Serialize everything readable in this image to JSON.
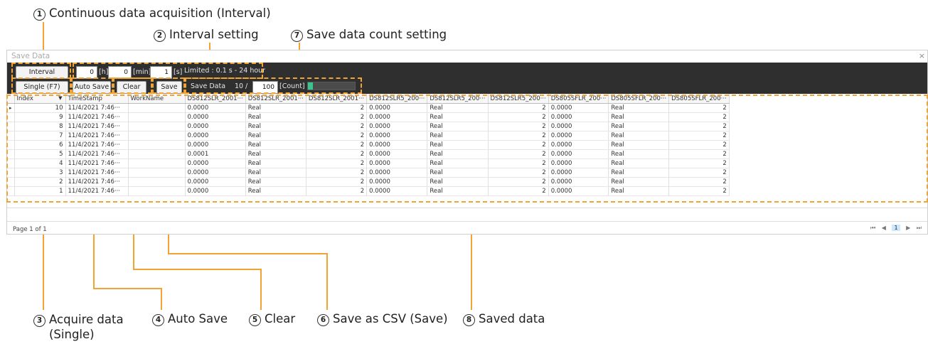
{
  "annotations": {
    "a1": {
      "num": "1",
      "text": "Continuous data acquisition (Interval)"
    },
    "a2": {
      "num": "2",
      "text": "Interval setting"
    },
    "a7": {
      "num": "7",
      "text": "Save data count setting"
    },
    "a3": {
      "num": "3",
      "text": "Acquire data",
      "text2": "(Single)"
    },
    "a4": {
      "num": "4",
      "text": "Auto Save"
    },
    "a5": {
      "num": "5",
      "text": "Clear"
    },
    "a6": {
      "num": "6",
      "text": "Save as CSV (Save)"
    },
    "a8": {
      "num": "8",
      "text": "Saved data"
    }
  },
  "window": {
    "title": "Save Data",
    "close": "×"
  },
  "toolbar": {
    "interval_label": "Interval",
    "hours": "0",
    "hours_unit": "[h]",
    "minutes": "0",
    "minutes_unit": "[min]",
    "seconds": "1",
    "seconds_unit": "[s]",
    "limit_text": "Limited : 0.1 s - 24 hour",
    "single_label": "Single (F7)",
    "autosave_label": "Auto Save",
    "clear_label": "Clear",
    "save_label": "Save",
    "save_data_label": "Save Data",
    "current_count": "10",
    "slash": "/",
    "max_count": "100",
    "count_unit": "[Count]",
    "progress_fraction": 0.1,
    "progress_color": "#3cc28c"
  },
  "grid": {
    "columns": [
      "Index",
      "TimeStamp",
      "WorkName",
      "DS812SLR_2001···",
      "DS812SLR_2001···",
      "DS812SLR_2001···",
      "DS812SLR5_200···",
      "DS812SLR5_200···",
      "DS812SLR5_200···",
      "DS805SFLR_200···",
      "DS805SFLR_200···",
      "DS805SFLR_200···"
    ],
    "sort_indicator": "▼",
    "row_indicator": "▸",
    "rows": [
      [
        "10",
        "11/4/2021 7:46···",
        "",
        "0.0000",
        "Real",
        "2",
        "0.0000",
        "Real",
        "2",
        "0.0000",
        "Real",
        "2"
      ],
      [
        "9",
        "11/4/2021 7:46···",
        "",
        "0.0000",
        "Real",
        "2",
        "0.0000",
        "Real",
        "2",
        "0.0000",
        "Real",
        "2"
      ],
      [
        "8",
        "11/4/2021 7:46···",
        "",
        "0.0000",
        "Real",
        "2",
        "0.0000",
        "Real",
        "2",
        "0.0000",
        "Real",
        "2"
      ],
      [
        "7",
        "11/4/2021 7:46···",
        "",
        "0.0000",
        "Real",
        "2",
        "0.0000",
        "Real",
        "2",
        "0.0000",
        "Real",
        "2"
      ],
      [
        "6",
        "11/4/2021 7:46···",
        "",
        "0.0000",
        "Real",
        "2",
        "0.0000",
        "Real",
        "2",
        "0.0000",
        "Real",
        "2"
      ],
      [
        "5",
        "11/4/2021 7:46···",
        "",
        "0.0001",
        "Real",
        "2",
        "0.0000",
        "Real",
        "2",
        "0.0000",
        "Real",
        "2"
      ],
      [
        "4",
        "11/4/2021 7:46···",
        "",
        "0.0000",
        "Real",
        "2",
        "0.0000",
        "Real",
        "2",
        "0.0000",
        "Real",
        "2"
      ],
      [
        "3",
        "11/4/2021 7:46···",
        "",
        "0.0000",
        "Real",
        "2",
        "0.0000",
        "Real",
        "2",
        "0.0000",
        "Real",
        "2"
      ],
      [
        "2",
        "11/4/2021 7:46···",
        "",
        "0.0000",
        "Real",
        "2",
        "0.0000",
        "Real",
        "2",
        "0.0000",
        "Real",
        "2"
      ],
      [
        "1",
        "11/4/2021 7:46···",
        "",
        "0.0000",
        "Real",
        "2",
        "0.0000",
        "Real",
        "2",
        "0.0000",
        "Real",
        "2"
      ]
    ]
  },
  "pager": {
    "text": "Page 1 of 1",
    "first": "⏮",
    "prev": "◀",
    "current": "1",
    "next": "▶",
    "last": "⏭"
  },
  "colors": {
    "annotation_orange": "#f1a433",
    "toolbar_bg": "#2f2f2f"
  }
}
